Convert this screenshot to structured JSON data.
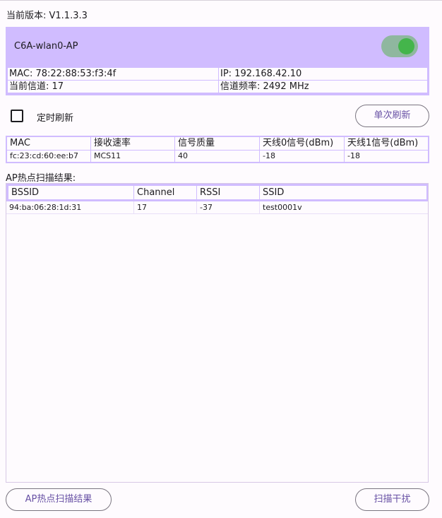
{
  "version_text": "当前版本: V1.1.3.3",
  "interface": {
    "name": "C6A-wlan0-AP",
    "enabled": true,
    "mac": "MAC: 78:22:88:53:f3:4f",
    "ip": "IP: 192.168.42.10",
    "channel": "当前信道: 17",
    "frequency": "信道频率: 2492 MHz"
  },
  "auto_refresh": {
    "label": "定时刷新",
    "checked": false
  },
  "single_refresh_label": "单次刷新",
  "stations": {
    "headers": [
      "MAC",
      "接收速率",
      "信号质量",
      "天线0信号(dBm)",
      "天线1信号(dBm)"
    ],
    "rows": [
      [
        "fc:23:cd:60:ee:b7",
        "MCS11",
        "40",
        "-18",
        "-18"
      ]
    ]
  },
  "scan": {
    "title": "AP热点扫描结果:",
    "headers": [
      "BSSID",
      "Channel",
      "RSSI",
      "SSID"
    ],
    "rows": [
      [
        "94:ba:06:28:1d:31",
        "17",
        "-37",
        "test0001v"
      ]
    ]
  },
  "bottom": {
    "scan_button": "AP热点扫描结果",
    "interference_button": "扫描干扰"
  },
  "colors": {
    "accent": "#d0bcff",
    "primary": "#6750a4",
    "toggle_on": "#44b54b"
  }
}
